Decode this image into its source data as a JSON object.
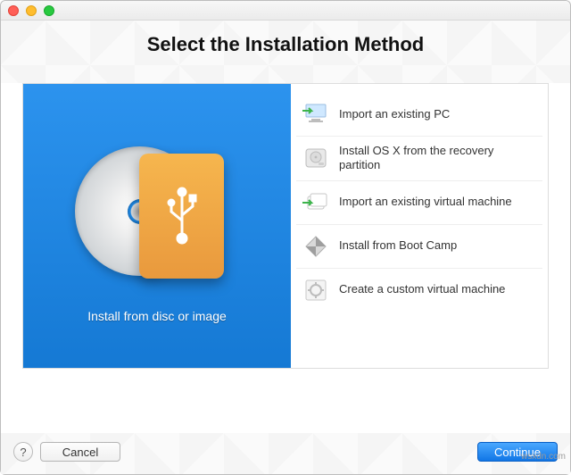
{
  "window": {
    "title": ""
  },
  "header": {
    "title": "Select the Installation Method"
  },
  "selected_panel": {
    "caption": "Install from disc or image"
  },
  "options": [
    {
      "icon": "monitor-arrow-icon",
      "label": "Import an existing PC"
    },
    {
      "icon": "harddrive-icon",
      "label": "Install OS X from the recovery partition"
    },
    {
      "icon": "vm-import-icon",
      "label": "Import an existing virtual machine"
    },
    {
      "icon": "bootcamp-icon",
      "label": "Install from Boot Camp"
    },
    {
      "icon": "custom-vm-icon",
      "label": "Create a custom virtual machine"
    }
  ],
  "footer": {
    "help_label": "?",
    "cancel_label": "Cancel",
    "continue_label": "Continue"
  },
  "watermark": "wsxdn.com",
  "colors": {
    "accent": "#1f8ae8",
    "primary_button": "#1a82f0"
  }
}
